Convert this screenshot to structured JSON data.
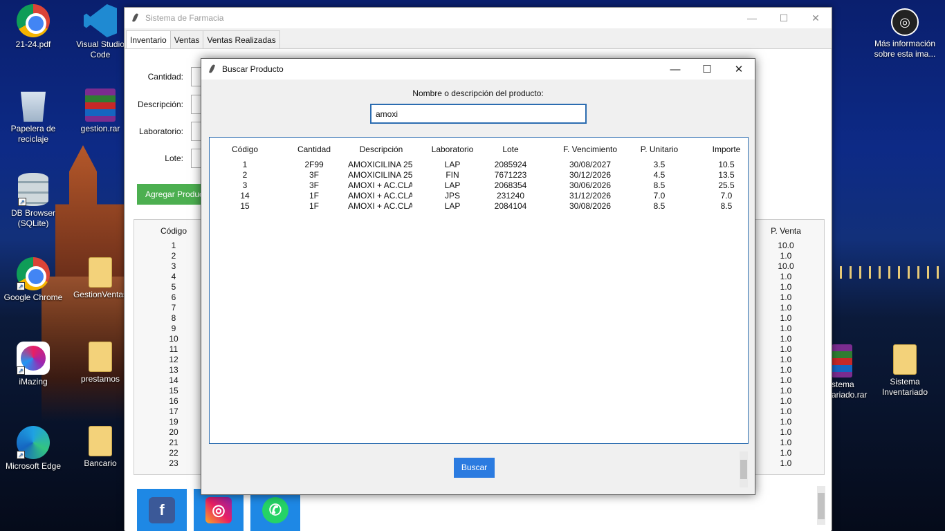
{
  "desktop": {
    "icons": [
      {
        "label": "21-24.pdf"
      },
      {
        "label": "Visual Studio Code"
      },
      {
        "label": "Papelera de reciclaje"
      },
      {
        "label": "gestion.rar"
      },
      {
        "label": "DB Browser (SQLite)"
      },
      {
        "label": "Google Chrome"
      },
      {
        "label": "GestionVentas"
      },
      {
        "label": "iMazing"
      },
      {
        "label": "prestamos"
      },
      {
        "label": "Microsoft Edge"
      },
      {
        "label": "Bancario"
      },
      {
        "label": "Más información sobre esta ima..."
      },
      {
        "label": "stema ariado.rar"
      },
      {
        "label": "Sistema Inventariado"
      }
    ]
  },
  "main_window": {
    "title": "Sistema de Farmacia",
    "tabs": [
      {
        "label": "Inventario"
      },
      {
        "label": "Ventas"
      },
      {
        "label": "Ventas Realizadas"
      }
    ],
    "form": {
      "cantidad_label": "Cantidad:",
      "descripcion_label": "Descripción:",
      "laboratorio_label": "Laboratorio:",
      "lote_label": "Lote:",
      "add_button": "Agregar Producto"
    },
    "inventory": {
      "col_codigo": "Código",
      "col_pventa": "P. Venta",
      "codigos": [
        "1",
        "2",
        "3",
        "4",
        "5",
        "6",
        "7",
        "8",
        "9",
        "10",
        "11",
        "12",
        "13",
        "14",
        "15",
        "16",
        "17",
        "19",
        "20",
        "21",
        "22",
        "23"
      ],
      "pventas": [
        "10.0",
        "1.0",
        "10.0",
        "1.0",
        "1.0",
        "1.0",
        "1.0",
        "1.0",
        "1.0",
        "1.0",
        "1.0",
        "1.0",
        "1.0",
        "1.0",
        "1.0",
        "1.0",
        "1.0",
        "1.0",
        "1.0",
        "1.0",
        "1.0",
        "1.0"
      ]
    },
    "social": [
      {
        "name": "facebook-icon",
        "glyph": "f"
      },
      {
        "name": "instagram-icon",
        "glyph": "◎"
      },
      {
        "name": "whatsapp-icon",
        "glyph": "✆"
      }
    ]
  },
  "dialog": {
    "title": "Buscar Producto",
    "search_label": "Nombre o descripción del producto:",
    "search_value": "amoxi",
    "columns": [
      "Código",
      "Cantidad",
      "Descripción",
      "Laboratorio",
      "Lote",
      "F. Vencimiento",
      "P. Unitario",
      "Importe"
    ],
    "rows": [
      [
        "1",
        "2F99",
        "AMOXICILINA 25(",
        "LAP",
        "2085924",
        "30/08/2027",
        "3.5",
        "10.5"
      ],
      [
        "2",
        "3F",
        "AMOXICILINA 25(",
        "FIN",
        "7671223",
        "30/12/2026",
        "4.5",
        "13.5"
      ],
      [
        "3",
        "3F",
        "AMOXI + AC.CLA",
        "LAP",
        "2068354",
        "30/06/2026",
        "8.5",
        "25.5"
      ],
      [
        "14",
        "1F",
        "AMOXI + AC.CLA",
        "JPS",
        "231240",
        "31/12/2026",
        "7.0",
        "7.0"
      ],
      [
        "15",
        "1F",
        "AMOXI + AC.CLA",
        "LAP",
        "2084104",
        "30/08/2026",
        "8.5",
        "8.5"
      ]
    ],
    "buscar_button": "Buscar"
  },
  "colors": {
    "accent": "#2b7be0",
    "green": "#4caf50",
    "facebook": "#3b5998",
    "whatsapp": "#25d366"
  }
}
